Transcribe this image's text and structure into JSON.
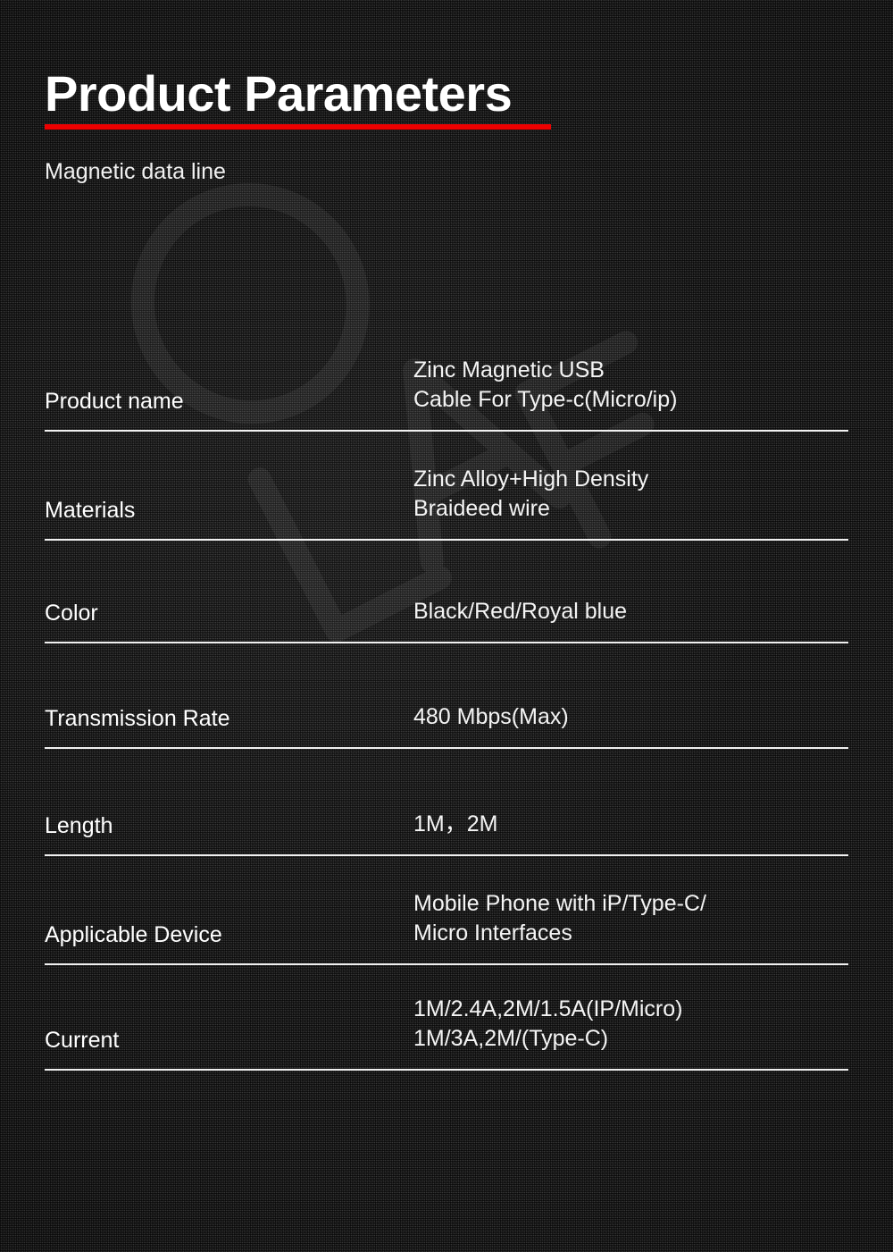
{
  "page": {
    "background_color": "#2b2b2b",
    "accent_color": "#ee0000",
    "text_color": "#ffffff",
    "watermark_text": "OLAF"
  },
  "header": {
    "title": "Product Parameters",
    "subtitle": "Magnetic data line"
  },
  "spec_table": {
    "rows": [
      {
        "label": "Product name",
        "value_lines": [
          "Zinc Magnetic USB",
          "Cable For Type-c(Micro/ip)"
        ]
      },
      {
        "label": "Materials",
        "value_lines": [
          "Zinc Alloy+High Density",
          "Braideed wire"
        ]
      },
      {
        "label": "Color",
        "value_lines": [
          "Black/Red/Royal blue"
        ]
      },
      {
        "label": "Transmission Rate",
        "value_lines": [
          "480 Mbps(Max)"
        ]
      },
      {
        "label": "Length",
        "value_lines": [
          "1M，2M"
        ]
      },
      {
        "label": "Applicable Device",
        "value_lines": [
          "Mobile Phone with iP/Type-C/",
          "Micro Interfaces"
        ]
      },
      {
        "label": "Current",
        "value_lines": [
          "1M/2.4A,2M/1.5A(IP/Micro)",
          "1M/3A,2M/(Type-C)"
        ]
      }
    ]
  }
}
